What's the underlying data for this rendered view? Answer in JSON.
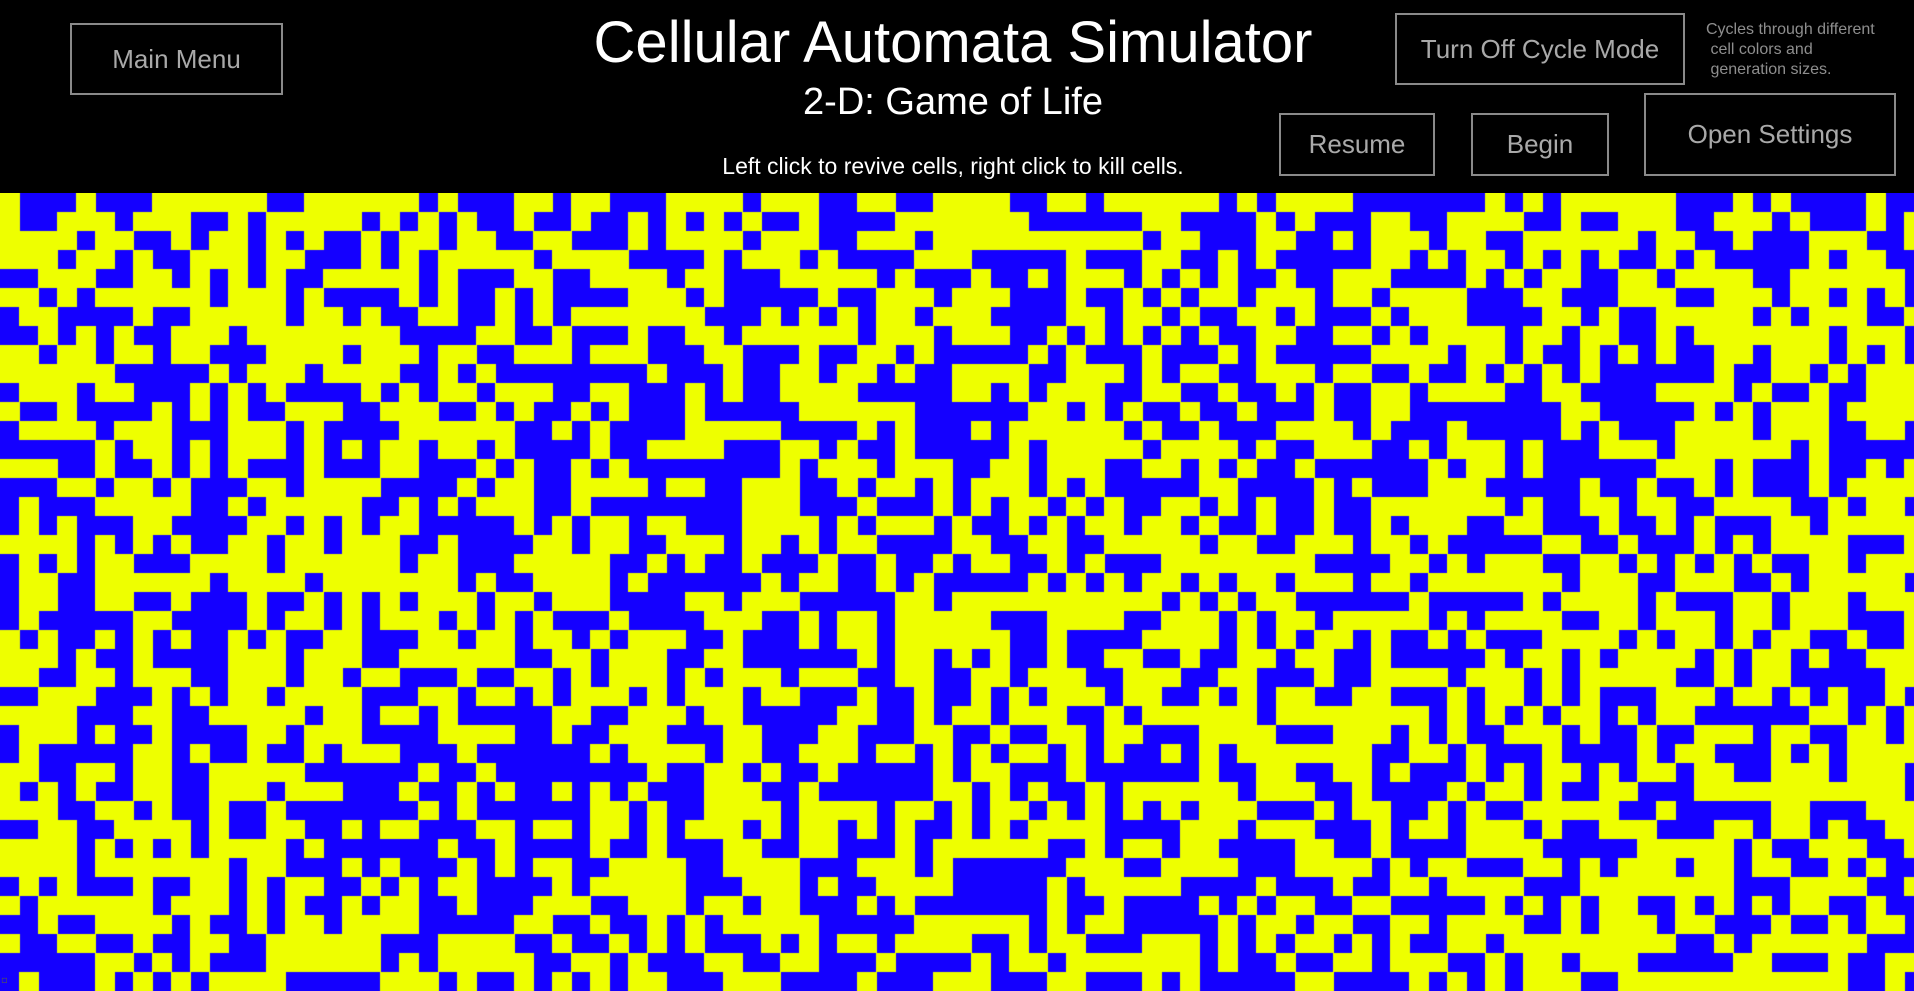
{
  "header": {
    "title": "Cellular Automata Simulator",
    "subtitle": "2-D: Game of Life",
    "instructions": "Left click to revive cells, right click to kill cells."
  },
  "buttons": {
    "main_menu": "Main Menu",
    "cycle_mode": "Turn Off Cycle Mode",
    "resume": "Resume",
    "begin": "Begin",
    "open_settings": "Open Settings"
  },
  "cycle_description": {
    "lines": [
      "Cycles through different",
      " cell colors and",
      " generation sizes."
    ]
  },
  "grid": {
    "alive_color": "#eeff00",
    "dead_color": "#1400ff",
    "columns": 101,
    "rows": 42
  },
  "colors": {
    "background": "#000000",
    "button_border": "#8a8a8a",
    "button_text": "#a9a9a9",
    "header_text": "#ffffff"
  }
}
